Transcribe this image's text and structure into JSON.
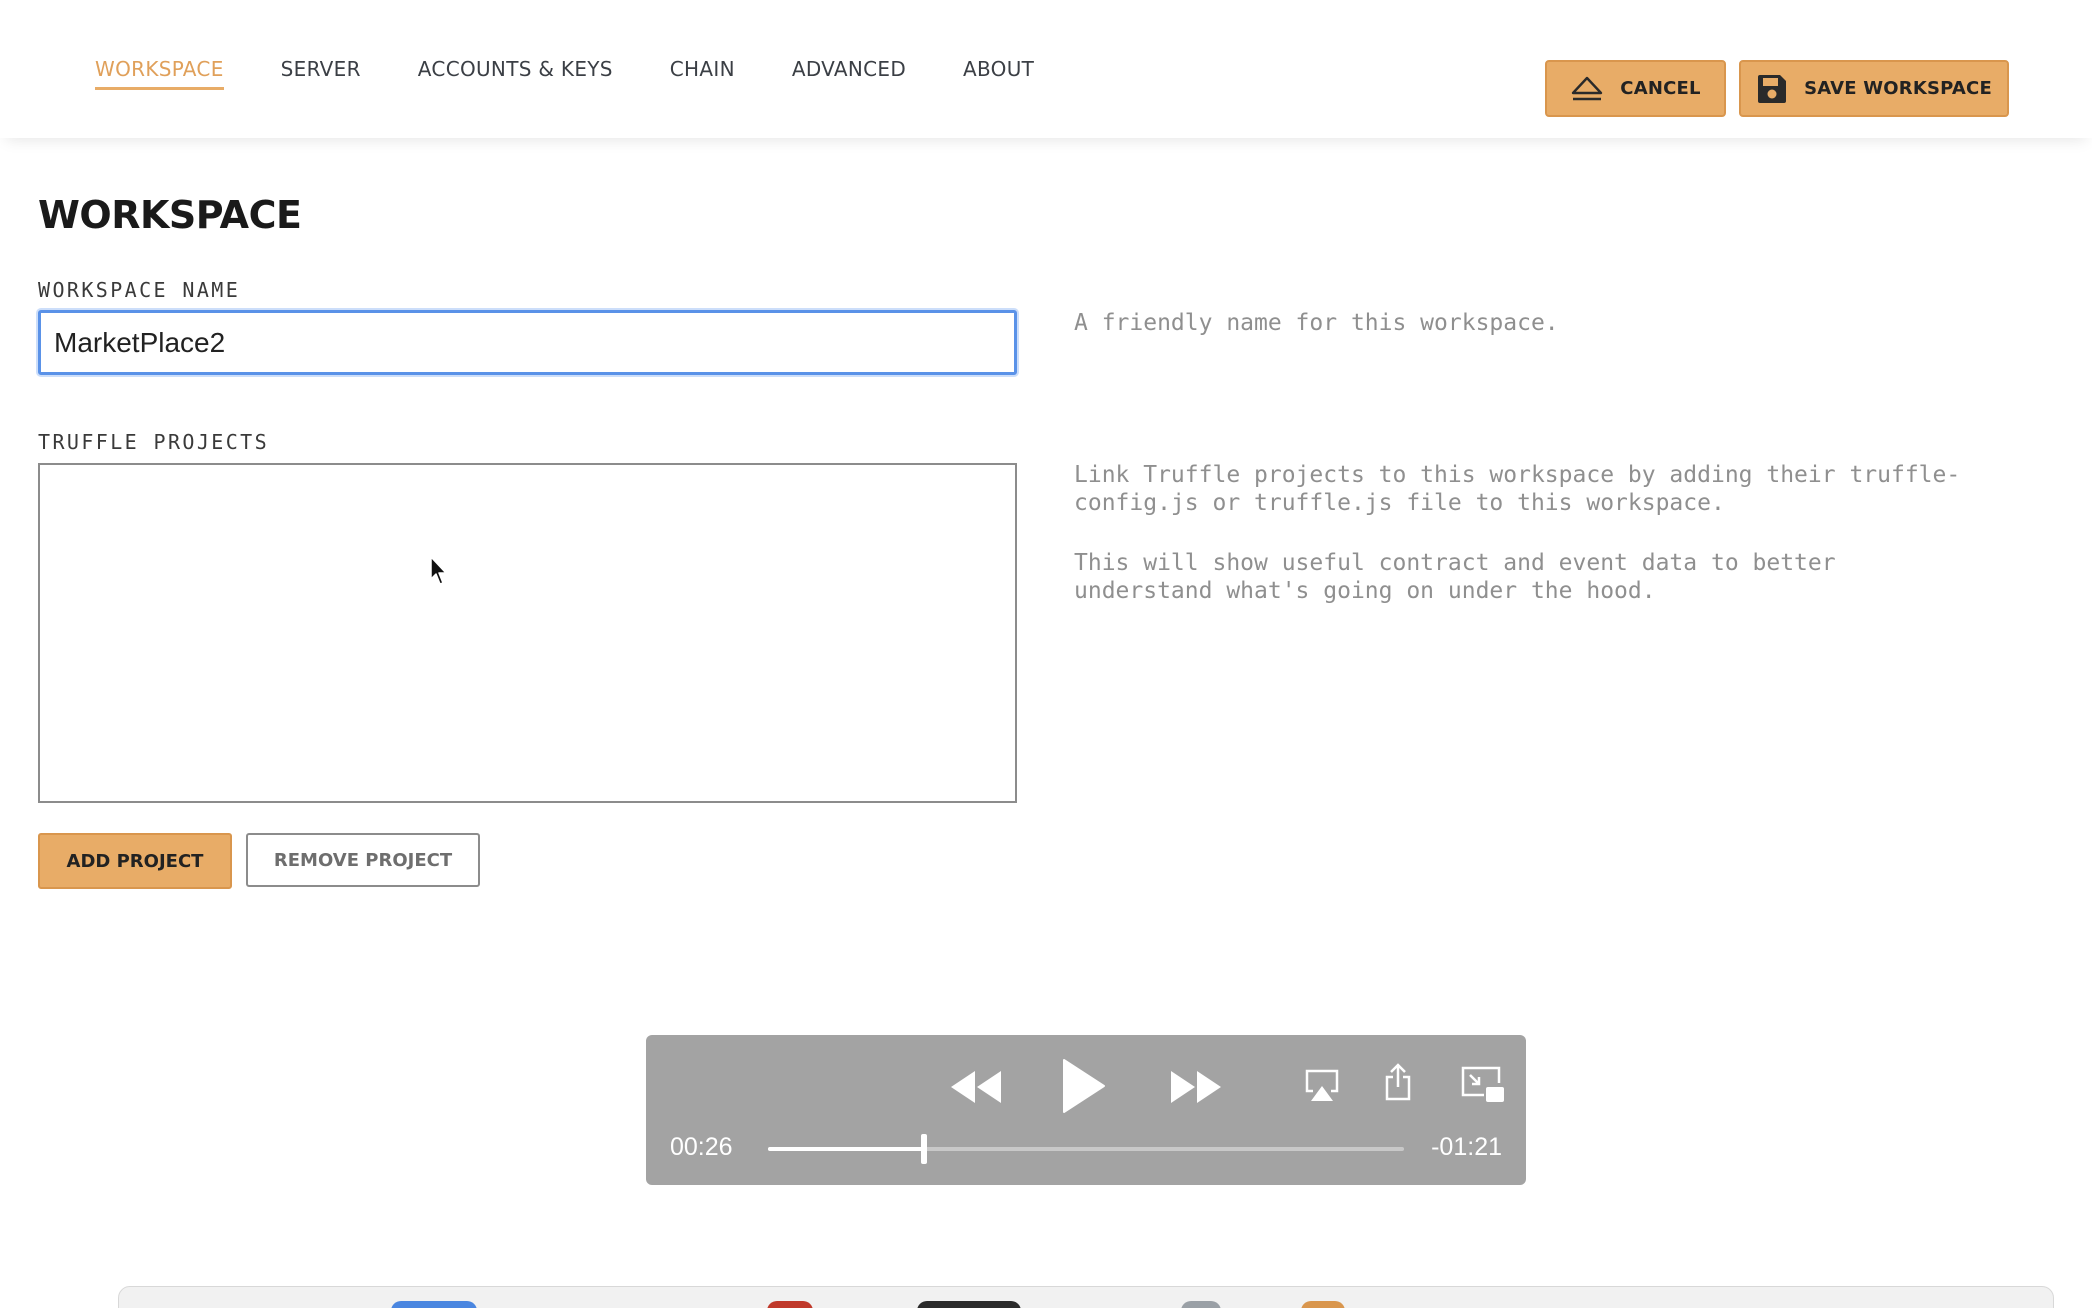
{
  "nav": {
    "tabs": [
      {
        "label": "WORKSPACE",
        "active": true
      },
      {
        "label": "SERVER",
        "active": false
      },
      {
        "label": "ACCOUNTS & KEYS",
        "active": false
      },
      {
        "label": "CHAIN",
        "active": false
      },
      {
        "label": "ADVANCED",
        "active": false
      },
      {
        "label": "ABOUT",
        "active": false
      }
    ],
    "cancel_label": "CANCEL",
    "cancel_icon": "eject-icon",
    "save_label": "SAVE WORKSPACE",
    "save_icon": "floppy-disk-icon"
  },
  "workspace": {
    "title": "WORKSPACE",
    "name_label": "WORKSPACE NAME",
    "name_value": "MarketPlace2",
    "name_help": "A friendly name for this workspace.",
    "projects_label": "TRUFFLE PROJECTS",
    "projects": [],
    "projects_help_1": "Link Truffle projects to this workspace by adding their truffle-\nconfig.js or truffle.js file to this workspace.",
    "projects_help_2": "This will show useful contract and event data to better\nunderstand what's going on under the hood.",
    "add_project_label": "ADD PROJECT",
    "remove_project_label": "REMOVE PROJECT"
  },
  "player": {
    "elapsed": "00:26",
    "remaining": "-01:21",
    "progress": 0.245,
    "icons": [
      "rewind-icon",
      "play-icon",
      "fast-forward-icon",
      "airplay-icon",
      "share-icon",
      "picture-in-picture-icon"
    ]
  },
  "colors": {
    "accent": "#e8ac67",
    "active_tab": "#e0a05a",
    "focus_ring": "#5a92e8",
    "player_bg": "#a3a3a3",
    "help_text": "#8f8f8f"
  }
}
